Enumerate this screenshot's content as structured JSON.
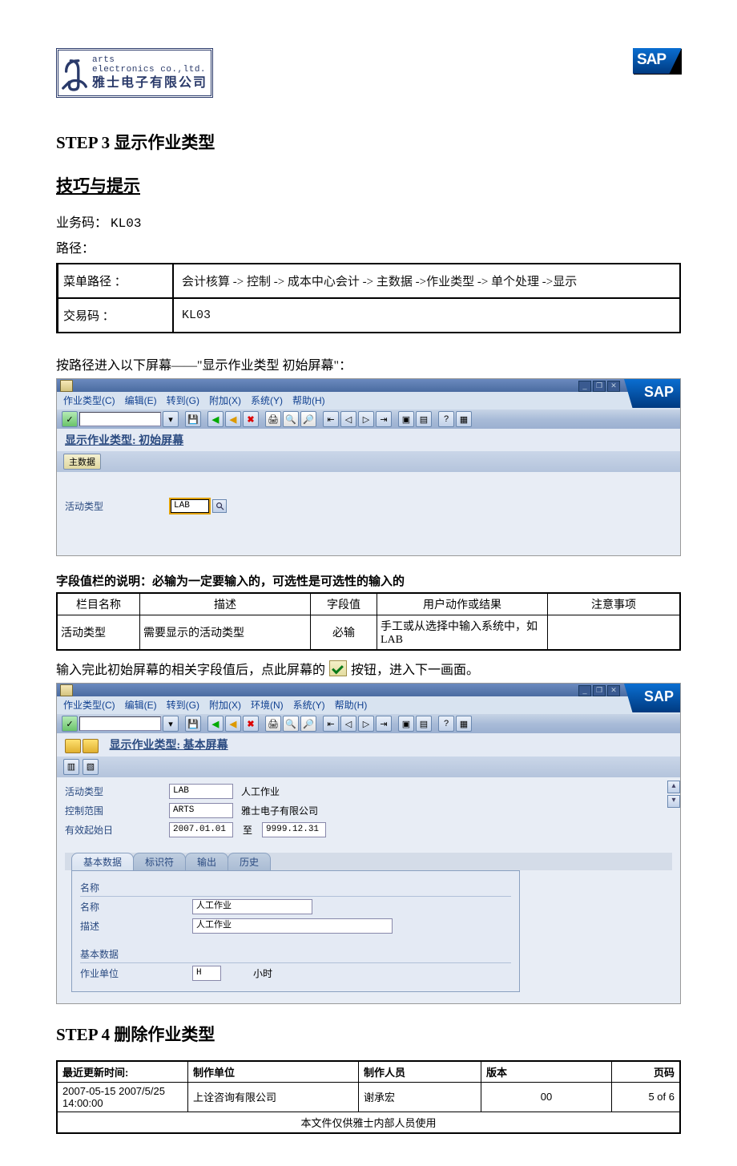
{
  "header": {
    "logo_en1": "arts",
    "logo_en2": "electronics co.,ltd.",
    "logo_cn": "雅士电子有限公司",
    "sap": "SAP"
  },
  "step3_title": "STEP 3 显示作业类型",
  "tips_title": "技巧与提示",
  "biz_code_label": "业务码：",
  "biz_code_value": "KL03",
  "path_label": "路径：",
  "path_table": {
    "menu_label": "菜单路径 ：",
    "menu_value": "会计核算 -> 控制 -> 成本中心会计 -> 主数据 ->作业类型 -> 单个处理 ->显示",
    "tcode_label": "交易码 ：",
    "tcode_value": "KL03"
  },
  "enter_screen_note": "按路径进入以下屏幕——\"显示作业类型 初始屏幕\"：",
  "sap1": {
    "menu": [
      "作业类型(C)",
      "编辑(E)",
      "转到(G)",
      "附加(X)",
      "系统(Y)",
      "帮助(H)"
    ],
    "title": "显示作业类型: 初始屏幕",
    "main_data_btn": "主数据",
    "field_label": "活动类型",
    "field_value": "LAB"
  },
  "field_explain_title": "字段值栏的说明：必输为一定要输入的，可选性是可选性的输入的",
  "field_table": {
    "headers": [
      "栏目名称",
      "描述",
      "字段值",
      "用户动作或结果",
      "注意事项"
    ],
    "row": [
      "活动类型",
      "需要显示的活动类型",
      "必输",
      "手工或从选择中输入系统中，如 LAB",
      ""
    ]
  },
  "afternote_a": "输入完此初始屏幕的相关字段值后，点此屏幕的",
  "afternote_b": "按钮，进入下一画面。",
  "sap2": {
    "menu": [
      "作业类型(C)",
      "编辑(E)",
      "转到(G)",
      "附加(X)",
      "环境(N)",
      "系统(Y)",
      "帮助(H)"
    ],
    "title": "显示作业类型: 基本屏幕",
    "rows": {
      "activity_label": "活动类型",
      "activity_val": "LAB",
      "activity_desc": "人工作业",
      "area_label": "控制范围",
      "area_val": "ARTS",
      "area_desc": "雅士电子有限公司",
      "valid_label": "有效起始日",
      "valid_from": "2007.01.01",
      "valid_mid": "至",
      "valid_to": "9999.12.31"
    },
    "tabs": [
      "基本数据",
      "标识符",
      "输出",
      "历史"
    ],
    "sec_name": "名称",
    "name_label": "名称",
    "name_val": "人工作业",
    "desc_label": "描述",
    "desc_val": "人工作业",
    "sec_basic": "基本数据",
    "unit_label": "作业单位",
    "unit_val": "H",
    "unit_desc": "小时"
  },
  "step4_title": "STEP 4 删除作业类型",
  "footer": {
    "headers": [
      "最近更新时间:",
      "制作单位",
      "制作人员",
      "版本",
      "页码"
    ],
    "row": [
      "2007-05-15 2007/5/25 14:00:00",
      "上诠咨询有限公司",
      "谢承宏",
      "00",
      "5 of 6"
    ],
    "note": "本文件仅供雅士内部人员使用"
  }
}
